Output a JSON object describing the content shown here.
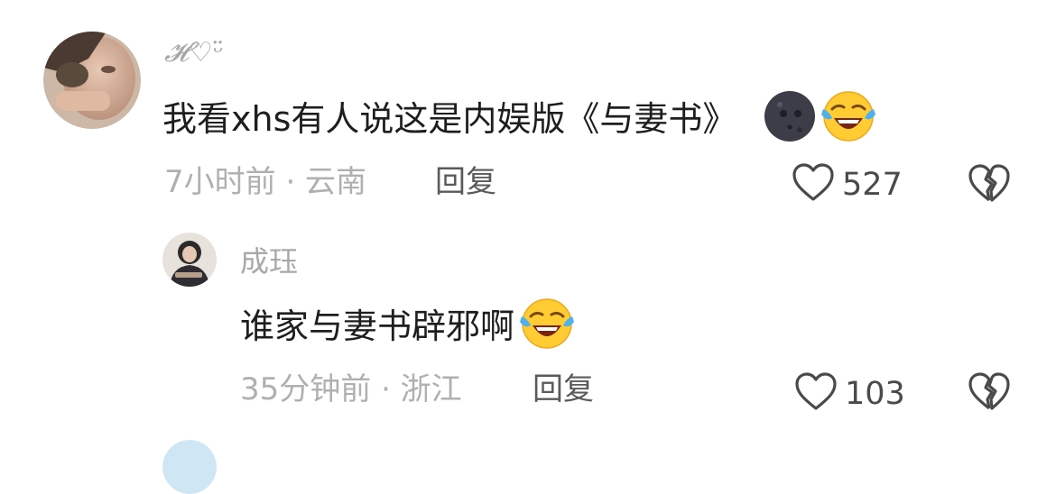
{
  "comments": [
    {
      "username": "𝓗♡ᵕ̈",
      "text": "我看xhs有人说这是内娱版《与妻书》",
      "emojis": [
        "new-moon-face-icon",
        "rolling-on-floor-laughing-icon"
      ],
      "time_location": "7小时前 · 云南",
      "reply_label": "回复",
      "likes": "527"
    },
    {
      "username": "成珏",
      "text": "谁家与妻书辟邪啊",
      "emojis": [
        "rolling-on-floor-laughing-icon"
      ],
      "time_location": "35分钟前 · 浙江",
      "reply_label": "回复",
      "likes": "103"
    }
  ],
  "colors": {
    "username": "#a8a8a8",
    "meta": "#b0b0b0",
    "reply": "#5a5a5a",
    "text": "#1e1e1e"
  }
}
